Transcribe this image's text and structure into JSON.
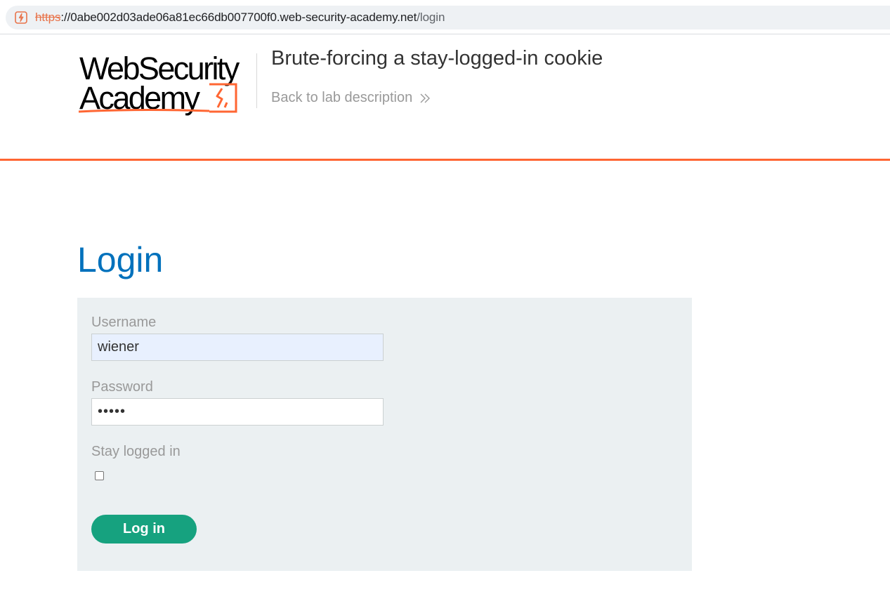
{
  "browser": {
    "url_scheme": "https",
    "url_host": "://0abe002d03ade06a81ec66db007700f0.web-security-academy.net",
    "url_path": "/login",
    "security_icon": "not-secure-lightning-icon",
    "scheme_color": "#e8734a"
  },
  "header": {
    "logo": {
      "line1": "WebSecurity",
      "line2": "Academy",
      "icon": "lightning-bolt-icon",
      "accent_color": "#ff6633"
    },
    "lab_title": "Brute-forcing a stay-logged-in cookie",
    "back_link": "Back to lab description",
    "back_link_icon": "double-chevron-right-icon",
    "rule_color": "#ff6633"
  },
  "main": {
    "title": "Login",
    "title_color": "#0071bc",
    "form": {
      "username_label": "Username",
      "username_value": "wiener",
      "password_label": "Password",
      "password_value": "peter",
      "stay_logged_in_label": "Stay logged in",
      "stay_logged_in_checked": false,
      "submit_label": "Log in",
      "button_color": "#16a27f",
      "panel_color": "#ebf0f2"
    }
  }
}
